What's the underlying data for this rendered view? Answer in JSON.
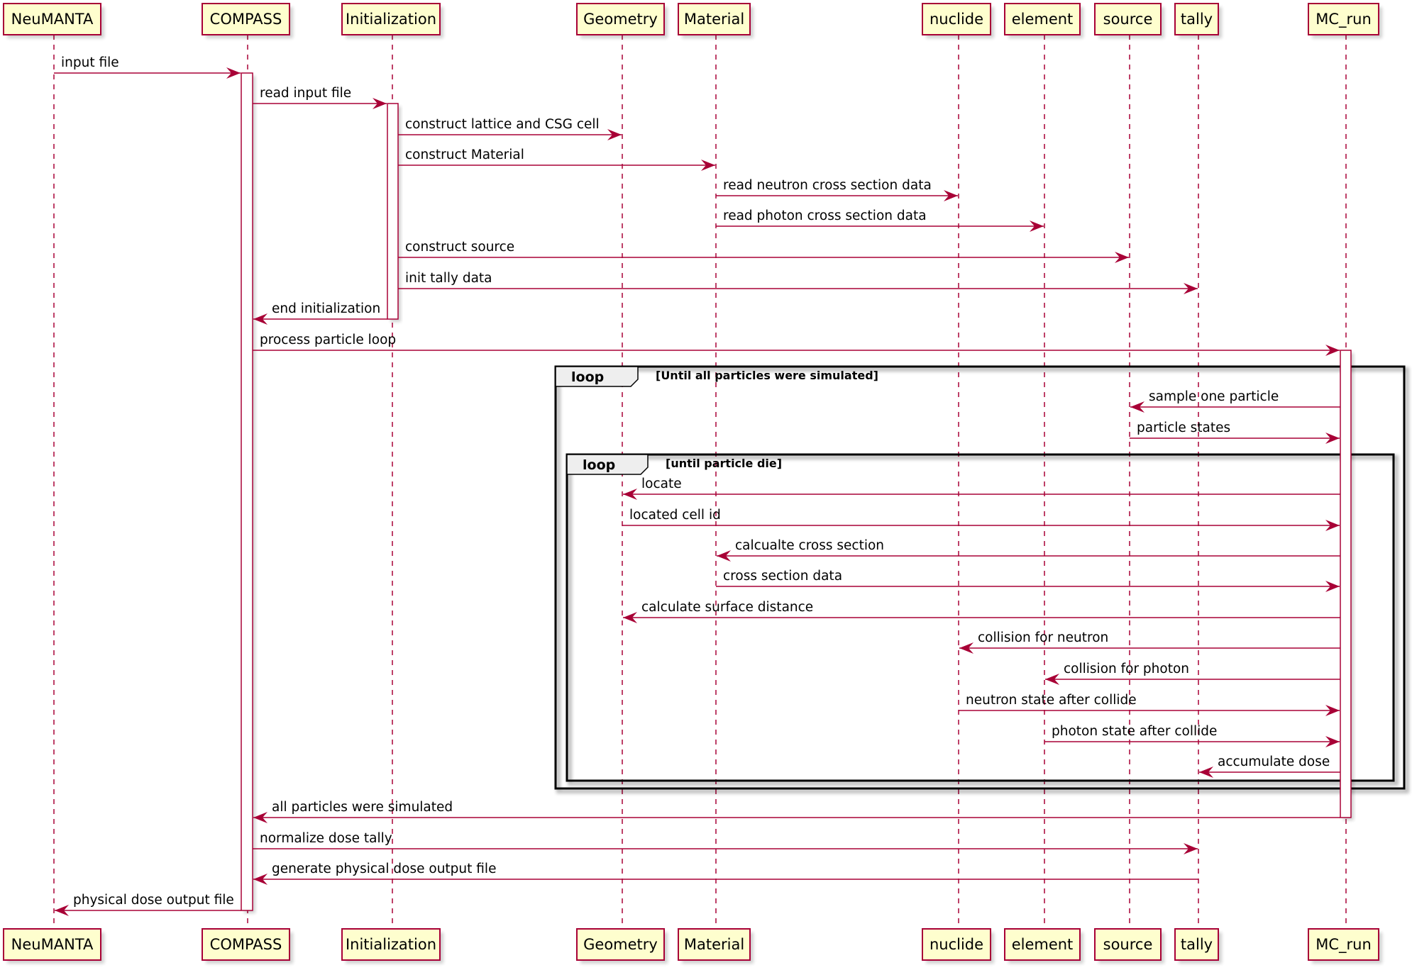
{
  "diagram": {
    "type": "sequence",
    "colors": {
      "participant_fill": "#FEFECE",
      "participant_border": "#A80036",
      "arrow": "#A80036",
      "frame_border": "#000000",
      "frame_tab": "#EEEEEE"
    },
    "participants": [
      {
        "id": "neumanta",
        "label": "NeuMANTA"
      },
      {
        "id": "compass",
        "label": "COMPASS"
      },
      {
        "id": "initialization",
        "label": "Initialization"
      },
      {
        "id": "geometry",
        "label": "Geometry"
      },
      {
        "id": "material",
        "label": "Material"
      },
      {
        "id": "nuclide",
        "label": "nuclide"
      },
      {
        "id": "element",
        "label": "element"
      },
      {
        "id": "source",
        "label": "source"
      },
      {
        "id": "tally",
        "label": "tally"
      },
      {
        "id": "mc_run",
        "label": "MC_run"
      }
    ],
    "messages": [
      {
        "from": "neumanta",
        "to": "compass",
        "label": "input file"
      },
      {
        "from": "compass",
        "to": "initialization",
        "label": "read input file"
      },
      {
        "from": "initialization",
        "to": "geometry",
        "label": "construct lattice and CSG cell"
      },
      {
        "from": "initialization",
        "to": "material",
        "label": "construct Material"
      },
      {
        "from": "material",
        "to": "nuclide",
        "label": "read neutron cross section data"
      },
      {
        "from": "material",
        "to": "element",
        "label": "read photon cross section data"
      },
      {
        "from": "initialization",
        "to": "source",
        "label": "construct source"
      },
      {
        "from": "initialization",
        "to": "tally",
        "label": "init tally data"
      },
      {
        "from": "initialization",
        "to": "compass",
        "label": "end initialization"
      },
      {
        "from": "compass",
        "to": "mc_run",
        "label": "process particle loop"
      },
      {
        "from": "mc_run",
        "to": "source",
        "label": "sample one particle"
      },
      {
        "from": "source",
        "to": "mc_run",
        "label": "particle states"
      },
      {
        "from": "mc_run",
        "to": "geometry",
        "label": "locate"
      },
      {
        "from": "geometry",
        "to": "mc_run",
        "label": "located cell id"
      },
      {
        "from": "mc_run",
        "to": "material",
        "label": "calcualte cross section"
      },
      {
        "from": "material",
        "to": "mc_run",
        "label": "cross section data"
      },
      {
        "from": "mc_run",
        "to": "geometry",
        "label": "calculate surface distance"
      },
      {
        "from": "mc_run",
        "to": "nuclide",
        "label": "collision for neutron"
      },
      {
        "from": "mc_run",
        "to": "element",
        "label": "collision for photon"
      },
      {
        "from": "nuclide",
        "to": "mc_run",
        "label": "neutron state after collide"
      },
      {
        "from": "element",
        "to": "mc_run",
        "label": "photon state after collide"
      },
      {
        "from": "mc_run",
        "to": "tally",
        "label": "accumulate dose"
      },
      {
        "from": "mc_run",
        "to": "compass",
        "label": "all particles were simulated"
      },
      {
        "from": "compass",
        "to": "tally",
        "label": "normalize dose tally"
      },
      {
        "from": "tally",
        "to": "compass",
        "label": "generate physical dose output file"
      },
      {
        "from": "compass",
        "to": "neumanta",
        "label": "physical dose output file"
      }
    ],
    "frames": [
      {
        "keyword": "loop",
        "guard": "[Until all particles were simulated]",
        "first_message": 10,
        "last_message": 21
      },
      {
        "keyword": "loop",
        "guard": "[until particle die]",
        "first_message": 12,
        "last_message": 21
      }
    ],
    "activations": [
      {
        "participant": "compass",
        "from_message": 0,
        "to_message": 25
      },
      {
        "participant": "initialization",
        "from_message": 1,
        "to_message": 8
      },
      {
        "participant": "mc_run",
        "from_message": 9,
        "to_message": 22
      }
    ]
  }
}
